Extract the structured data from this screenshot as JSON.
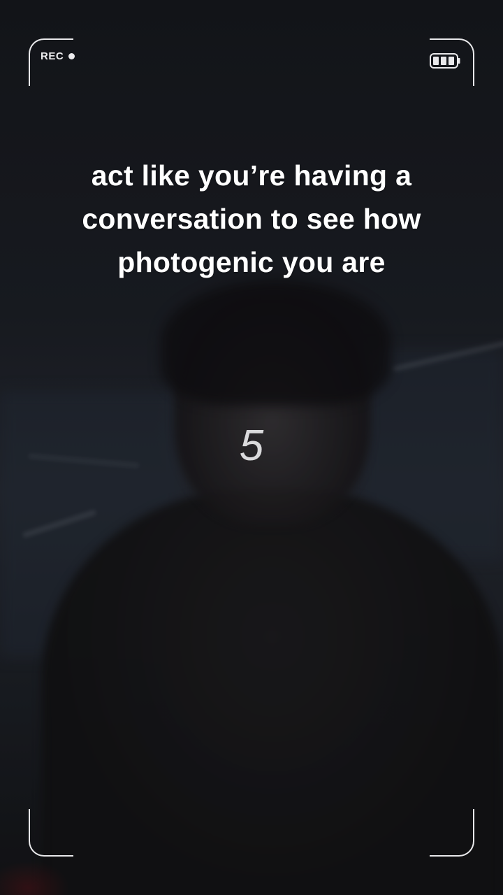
{
  "recording": {
    "label": "REC",
    "icon": "record-dot-icon"
  },
  "status": {
    "battery_icon": "battery-icon",
    "battery_level": 1.0
  },
  "caption": {
    "text": "act like you’re having a\nconversation to see how\nphotogenic you are"
  },
  "countdown": {
    "value": "5"
  },
  "colors": {
    "frame": "#e8e8ea",
    "caption_text": "#ffffff",
    "countdown_text": "#e4e4e6",
    "background": "#16181d"
  }
}
